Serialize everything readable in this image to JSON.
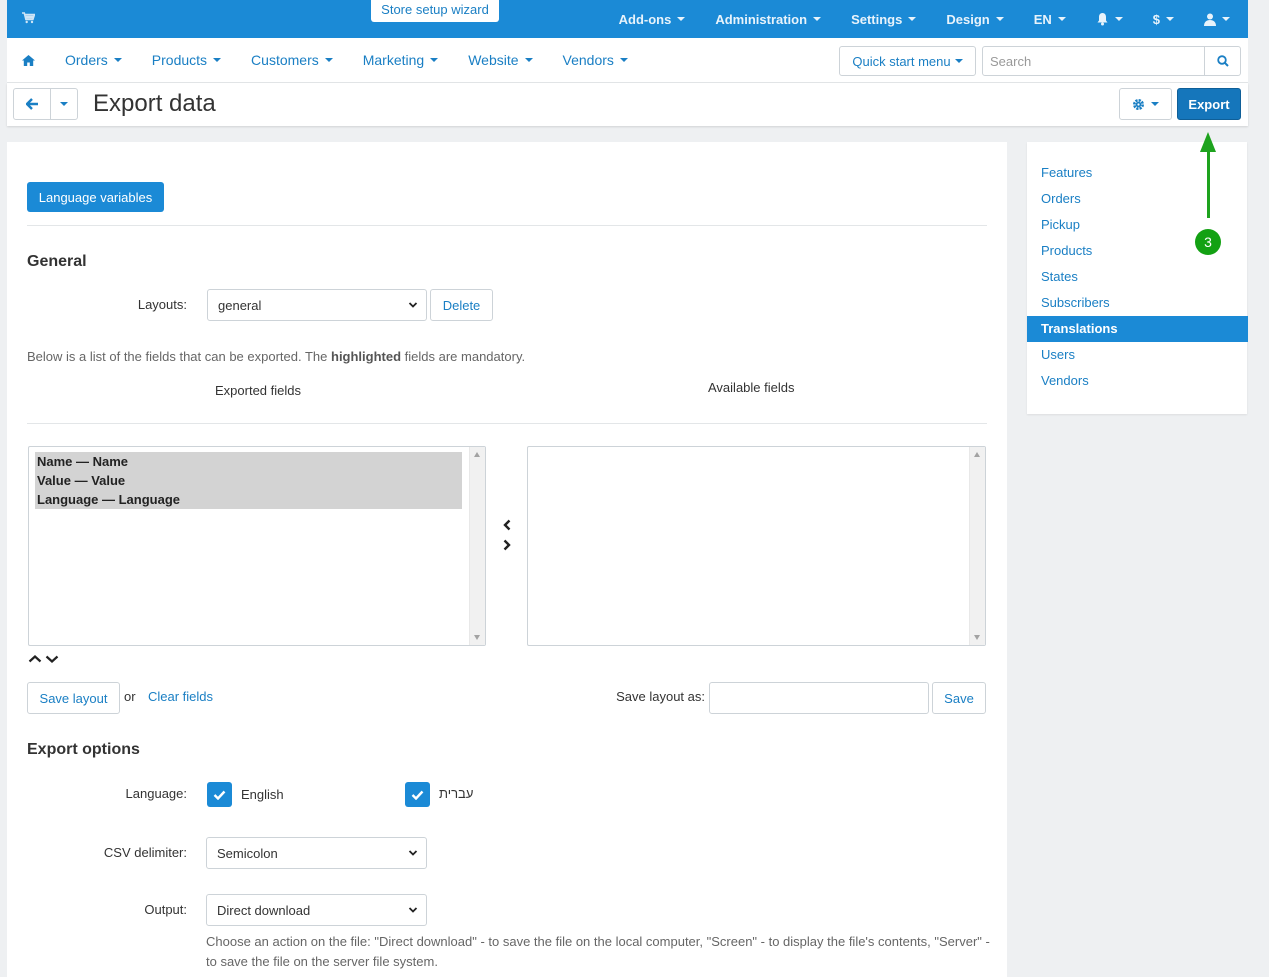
{
  "topbar": {
    "wizard_label": "Store setup wizard",
    "items": [
      "Add-ons",
      "Administration",
      "Settings",
      "Design",
      "EN"
    ]
  },
  "nav": {
    "items": [
      "Orders",
      "Products",
      "Customers",
      "Marketing",
      "Website",
      "Vendors"
    ],
    "quick_start_label": "Quick start menu",
    "search_placeholder": "Search"
  },
  "titlebar": {
    "title": "Export data",
    "export_label": "Export"
  },
  "main": {
    "language_variables_label": "Language variables",
    "general_heading": "General",
    "layouts_label": "Layouts:",
    "layout_value": "general",
    "delete_label": "Delete",
    "note_prefix": "Below is a list of the fields that can be exported. The ",
    "note_bold": "highlighted",
    "note_suffix": " fields are mandatory.",
    "exported_fields_heading": "Exported fields",
    "available_fields_heading": "Available fields",
    "exported_fields": [
      "Name — Name",
      "Value — Value",
      "Language — Language"
    ],
    "save_layout_label": "Save layout",
    "or_text": "or",
    "clear_fields_label": "Clear fields",
    "save_layout_as_label": "Save layout as:",
    "save_label": "Save",
    "export_options_heading": "Export options",
    "language_label": "Language:",
    "lang_english": "English",
    "lang_hebrew": "עברית",
    "csv_delimiter_label": "CSV delimiter:",
    "csv_delimiter_value": "Semicolon",
    "output_label": "Output:",
    "output_value": "Direct download",
    "output_help": "Choose an action on the file: \"Direct download\" - to save the file on the local computer, \"Screen\" - to display the file's contents, \"Server\" - to save the file on the server file system."
  },
  "sidebar": {
    "items": [
      "Features",
      "Orders",
      "Pickup",
      "Products",
      "States",
      "Subscribers",
      "Translations",
      "Users",
      "Vendors"
    ],
    "active": "Translations"
  },
  "annotation": {
    "badge": "3"
  },
  "colors": {
    "brand": "#1b8ad6",
    "export": "#1576bb",
    "annotation": "#1ea31e"
  }
}
